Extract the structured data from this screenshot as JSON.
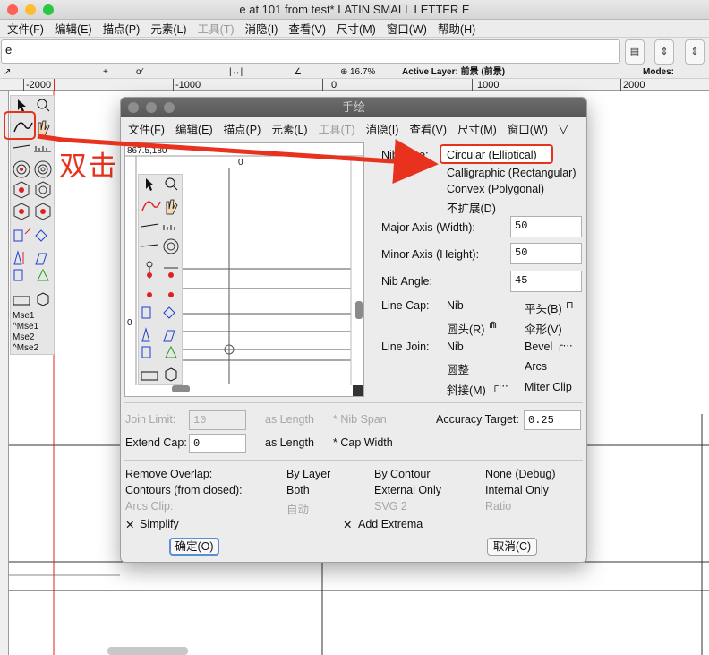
{
  "window": {
    "title": "e at 101 from test* LATIN SMALL LETTER E"
  },
  "menubar": [
    "文件(F)",
    "编辑(E)",
    "描点(P)",
    "元素(L)",
    "工具(T)",
    "消隐(I)",
    "查看(V)",
    "尺寸(M)",
    "窗口(W)",
    "帮助(H)"
  ],
  "menubar_disabled": [
    "工具(T)"
  ],
  "glyph_field": "e",
  "infobar": {
    "zoom": "16.7%",
    "active_layer": "Active Layer: 前景 (前景)",
    "modes": "Modes:"
  },
  "ruler": [
    "-2000",
    "-1000",
    "0",
    "1000",
    "2000"
  ],
  "palette": {
    "mse": [
      "Mse1",
      "^Mse1",
      "Mse2",
      "^Mse2"
    ]
  },
  "annotation": {
    "text": "双击",
    "color": "#e8321e"
  },
  "dialog": {
    "title": "手绘",
    "menu": [
      "文件(F)",
      "编辑(E)",
      "描点(P)",
      "元素(L)",
      "工具(T)",
      "消隐(I)",
      "查看(V)",
      "尺寸(M)",
      "窗口(W)"
    ],
    "coords": "867.5,180",
    "ruler_zero": "0",
    "nib_type": {
      "label": "Nib Type:",
      "options": [
        "Circular (Elliptical)",
        "Calligraphic (Rectangular)",
        "Convex (Polygonal)",
        "不扩展(D)"
      ],
      "selected": "Circular (Elliptical)"
    },
    "major_axis": {
      "label": "Major Axis (Width):",
      "value": "50"
    },
    "minor_axis": {
      "label": "Minor Axis (Height):",
      "value": "50"
    },
    "nib_angle": {
      "label": "Nib Angle:",
      "value": "45"
    },
    "line_cap": {
      "label": "Line Cap:",
      "options": [
        "Nib",
        "平头(B)",
        "圆头(R)",
        "伞形(V)"
      ]
    },
    "line_join": {
      "label": "Line Join:",
      "options": [
        "Nib",
        "Bevel",
        "圆整",
        "Arcs",
        "斜接(M)",
        "Miter Clip"
      ]
    },
    "join_limit": {
      "label": "Join Limit:",
      "value": "10",
      "unit": "as Length",
      "extra": "* Nib Span"
    },
    "accuracy": {
      "label": "Accuracy Target:",
      "value": "0.25"
    },
    "extend_cap": {
      "label": "Extend Cap:",
      "value": "0",
      "unit": "as Length",
      "extra": "* Cap Width"
    },
    "remove_overlap": {
      "label": "Remove Overlap:",
      "options": [
        "By Layer",
        "By Contour",
        "None (Debug)"
      ]
    },
    "contours": {
      "label": "Contours (from closed):",
      "options": [
        "Both",
        "External Only",
        "Internal Only"
      ]
    },
    "arcs_clip": {
      "label": "Arcs Clip:",
      "options": [
        "自动",
        "SVG 2",
        "Ratio"
      ]
    },
    "simplify": "Simplify",
    "add_extrema": "Add Extrema",
    "ok": "确定(O)",
    "cancel": "取消(C)"
  }
}
